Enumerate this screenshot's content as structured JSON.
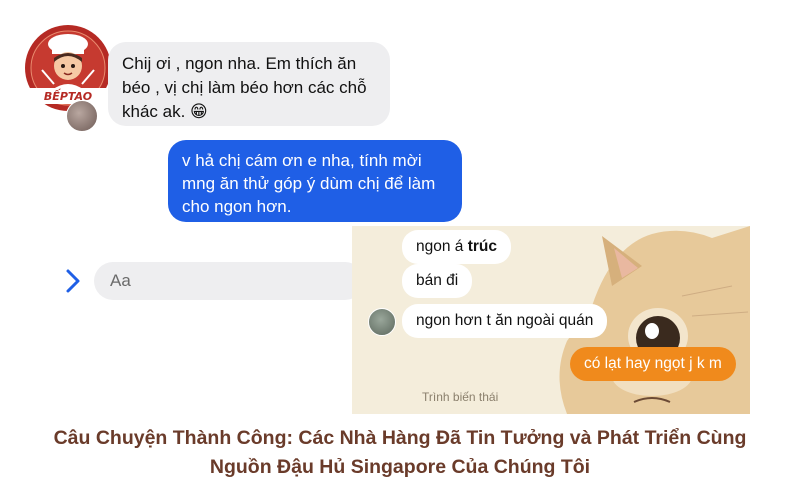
{
  "logo": {
    "text": "BẾPTAO",
    "icon": "chef-logo-icon"
  },
  "chat": {
    "incoming_message": "Chij ơi , ngon nha. Em thích ăn béo , vị chị làm béo hơn các chỗ khác ak. 😁",
    "outgoing_message": "v hả chị cám ơn e nha, tính mời mng ăn thử góp ý dùm chị để làm cho ngon hơn.",
    "input_placeholder": "Aa",
    "expand_icon": "chevron-right-icon",
    "outgoing_color": "#1f5fe6"
  },
  "screenshot2": {
    "msg1_prefix": "ngon á ",
    "msg1_bold": "trúc",
    "msg2": "bán đi",
    "msg3": "ngon hơn t ăn ngoài quán",
    "reply": "có lạt hay ngọt j k m",
    "reply_color": "#f08a1c",
    "label": "Trình biến thái"
  },
  "caption": {
    "line1": "Câu Chuyện Thành Công: Các Nhà Hàng Đã Tin Tưởng và Phát Triển Cùng",
    "line2": "Nguồn Đậu Hủ Singapore Của Chúng Tôi"
  }
}
